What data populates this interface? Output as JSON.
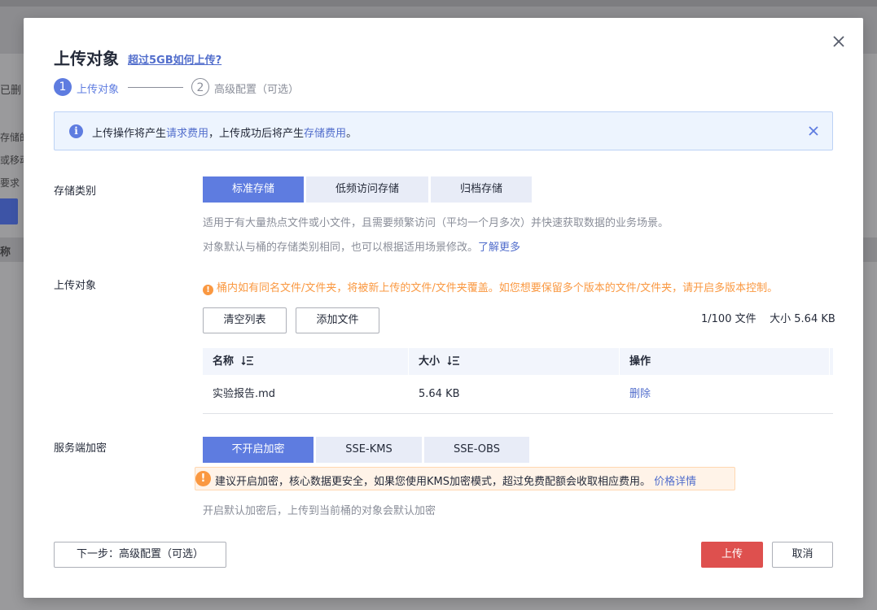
{
  "background": {
    "tab_fragment": "已删",
    "lines": [
      "存储的",
      "或移动",
      "要求"
    ],
    "col_fragment": "称"
  },
  "dialog": {
    "title": "上传对象",
    "help_link": "超过5GB如何上传?",
    "steps": [
      {
        "number": "1",
        "label": "上传对象"
      },
      {
        "number": "2",
        "label": "高级配置（可选）"
      }
    ],
    "info": {
      "text_before": "上传操作将产生",
      "link1": "请求费用",
      "text_middle": "，上传成功后将产生",
      "link2": "存储费用",
      "text_after": "。"
    },
    "storage": {
      "label": "存储类别",
      "options": [
        "标准存储",
        "低频访问存储",
        "归档存储"
      ],
      "selected": "标准存储",
      "hint1": "适用于有大量热点文件或小文件，且需要频繁访问（平均一个月多次）并快速获取数据的业务场景。",
      "hint2": "对象默认与桶的存储类别相同，也可以根据适用场景修改。",
      "hint2_link": "了解更多"
    },
    "upload": {
      "label": "上传对象",
      "warning": "桶内如有同名文件/文件夹，将被新上传的文件/文件夹覆盖。如您想要保留多个版本的文件/文件夹，请开启多版本控制。",
      "clear_button": "清空列表",
      "add_button": "添加文件",
      "count": "1/100 文件",
      "size": "大小 5.64 KB",
      "columns": [
        "名称",
        "大小",
        "操作"
      ],
      "rows": [
        {
          "name": "实验报告.md",
          "size": "5.64 KB",
          "action": "删除"
        }
      ]
    },
    "encryption": {
      "label": "服务端加密",
      "options": [
        "不开启加密",
        "SSE-KMS",
        "SSE-OBS"
      ],
      "selected": "不开启加密",
      "warning": "建议开启加密，核心数据更安全，如果您使用KMS加密模式，超过免费配额会收取相应费用。",
      "warning_link": "价格详情",
      "hint": "开启默认加密后，上传到当前桶的对象会默认加密"
    },
    "footer": {
      "next_button": "下一步：高级配置（可选）",
      "upload_button": "上传",
      "cancel_button": "取消"
    },
    "colors": {
      "primary": "#5e7ce0",
      "link": "#526ecc",
      "danger": "#de504e",
      "warning": "#fa9841"
    }
  }
}
